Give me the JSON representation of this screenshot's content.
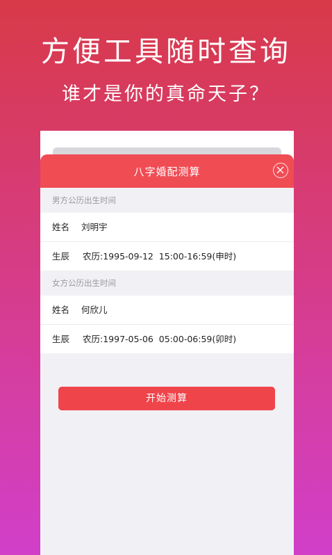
{
  "promo": {
    "title": "方便工具随时查询",
    "subtitle": "谁才是你的真命天子？"
  },
  "dialog": {
    "title": "八字婚配测算",
    "close_icon": "close-icon",
    "male": {
      "section_title": "男方公历出生时间",
      "name_label": "姓名",
      "name_value": "刘明宇",
      "birth_label": "生辰",
      "birth_value": "农历:1995-09-12  15:00-16:59(申时)"
    },
    "female": {
      "section_title": "女方公历出生时间",
      "name_label": "姓名",
      "name_value": "何欣儿",
      "birth_label": "生辰",
      "birth_value": "农历:1997-05-06  05:00-06:59(卯时)"
    },
    "submit_label": "开始测算"
  },
  "colors": {
    "accent": "#f04c54",
    "button": "#f0444b"
  }
}
